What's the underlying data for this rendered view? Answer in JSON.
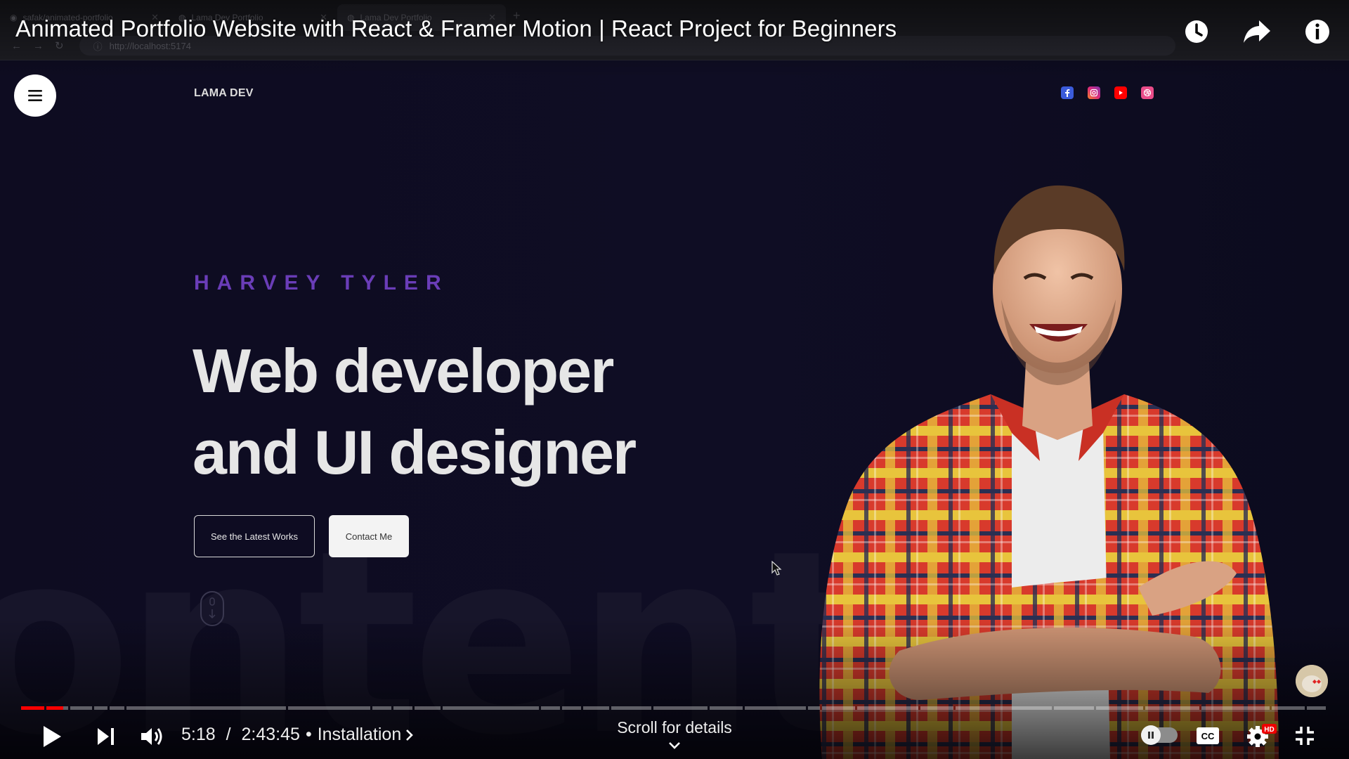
{
  "video": {
    "title": "Animated Portfolio Website with React & Framer Motion | React Project for Beginners"
  },
  "browser": {
    "tabs": [
      {
        "title": "safak/animated-portfolio"
      },
      {
        "title": "Lama Dev Portfolio"
      },
      {
        "title": "Lama Dev Portfolio"
      }
    ],
    "url": "http://localhost:5174"
  },
  "portfolio": {
    "brand": "LAMA DEV",
    "hero_name": "HARVEY TYLER",
    "hero_title_line1": "Web developer",
    "hero_title_line2": "and UI designer",
    "btn_works": "See the Latest Works",
    "btn_contact": "Contact Me",
    "background_word": "ontent",
    "socials": [
      {
        "name": "facebook",
        "color": "#3b5bdb"
      },
      {
        "name": "instagram",
        "color": "#e1306c"
      },
      {
        "name": "youtube",
        "color": "#ff0000"
      },
      {
        "name": "dribbble",
        "color": "#ea4c89"
      }
    ]
  },
  "player": {
    "current_time": "5:18",
    "duration": "2:43:45",
    "chapter": "Installation",
    "time_sep": " / ",
    "chapter_sep": "•",
    "scroll_hint": "Scroll for details",
    "hd_badge": "HD",
    "cc_label": "CC",
    "played_fraction": 0.032
  },
  "colors": {
    "accent": "#ff0000",
    "hero_name": "#6a3db8",
    "page_bg": "#0f0d24"
  }
}
